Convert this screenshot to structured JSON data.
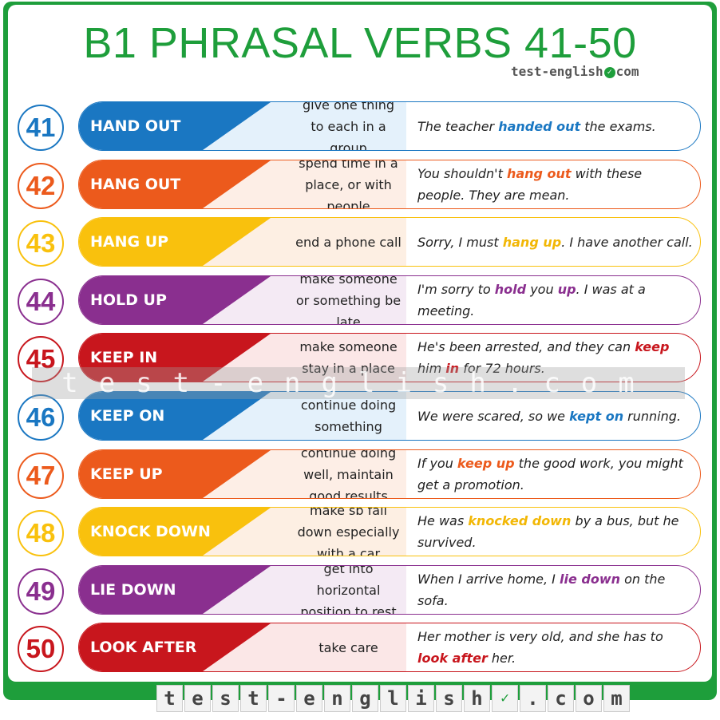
{
  "title": "B1 PHRASAL VERBS 41-50",
  "brand_small": {
    "left": "test-english",
    "right": "com"
  },
  "footer_tiles": [
    "t",
    "e",
    "s",
    "t",
    "-",
    "e",
    "n",
    "g",
    "l",
    "i",
    "s",
    "h",
    "✓",
    ".",
    "c",
    "o",
    "m"
  ],
  "watermark": "test-english.com",
  "rows": [
    {
      "num": "41",
      "verb": "HAND OUT",
      "def": "give one thing to each in a group",
      "color": "#1a77c2",
      "light": "#e4f1fb",
      "ex": [
        {
          "t": "The teacher "
        },
        {
          "t": "handed out",
          "h": 1
        },
        {
          "t": " the exams."
        }
      ]
    },
    {
      "num": "42",
      "verb": "HANG OUT",
      "def": "spend time in a place, or with people",
      "color": "#ec5a1c",
      "light": "#fdeee6",
      "ex": [
        {
          "t": "You shouldn't "
        },
        {
          "t": "hang out",
          "h": 1
        },
        {
          "t": " with these people. They are mean."
        }
      ]
    },
    {
      "num": "43",
      "verb": "HANG UP",
      "def": "end a phone call",
      "color": "#f9c10d",
      "light": "#fdefe3",
      "ex": [
        {
          "t": "Sorry, I must "
        },
        {
          "t": "hang up",
          "h": 1
        },
        {
          "t": ". I have another call."
        }
      ]
    },
    {
      "num": "44",
      "verb": "HOLD UP",
      "def": "make someone or something be late",
      "color": "#8a2f8f",
      "light": "#f4eaf4",
      "ex": [
        {
          "t": "I'm sorry to "
        },
        {
          "t": "hold",
          "h": 1
        },
        {
          "t": " you "
        },
        {
          "t": "up",
          "h": 1
        },
        {
          "t": ". I was at a meeting."
        }
      ]
    },
    {
      "num": "45",
      "verb": "KEEP IN",
      "def": "make someone stay in a place",
      "color": "#c8161d",
      "light": "#fbe7e7",
      "ex": [
        {
          "t": "He's been arrested, and they can "
        },
        {
          "t": "keep",
          "h": 1
        },
        {
          "t": " him "
        },
        {
          "t": "in",
          "h": 1
        },
        {
          "t": " for 72 hours."
        }
      ]
    },
    {
      "num": "46",
      "verb": "KEEP ON",
      "def": "continue doing something",
      "color": "#1a77c2",
      "light": "#e4f1fb",
      "ex": [
        {
          "t": "We were scared, so we "
        },
        {
          "t": "kept on",
          "h": 1
        },
        {
          "t": " running."
        }
      ]
    },
    {
      "num": "47",
      "verb": "KEEP UP",
      "def": "continue doing well, maintain good results",
      "color": "#ec5a1c",
      "light": "#fdeee6",
      "ex": [
        {
          "t": "If you "
        },
        {
          "t": "keep up",
          "h": 1
        },
        {
          "t": " the good work, you might get a promotion."
        }
      ]
    },
    {
      "num": "48",
      "verb": "KNOCK DOWN",
      "def": "make sb fall down especially with a car",
      "color": "#f9c10d",
      "light": "#fdefe3",
      "ex": [
        {
          "t": "He was "
        },
        {
          "t": "knocked down",
          "h": 1
        },
        {
          "t": " by a bus, but he survived."
        }
      ]
    },
    {
      "num": "49",
      "verb": "LIE DOWN",
      "def": "get into horizontal position to rest",
      "color": "#8a2f8f",
      "light": "#f4eaf4",
      "ex": [
        {
          "t": "When I arrive home, I "
        },
        {
          "t": "lie down",
          "h": 1
        },
        {
          "t": " on the sofa."
        }
      ]
    },
    {
      "num": "50",
      "verb": "LOOK AFTER",
      "def": "take care",
      "color": "#c8161d",
      "light": "#fbe7e7",
      "ex": [
        {
          "t": "Her mother is very old, and she has to "
        },
        {
          "t": "look after",
          "h": 1
        },
        {
          "t": " her."
        }
      ]
    }
  ]
}
